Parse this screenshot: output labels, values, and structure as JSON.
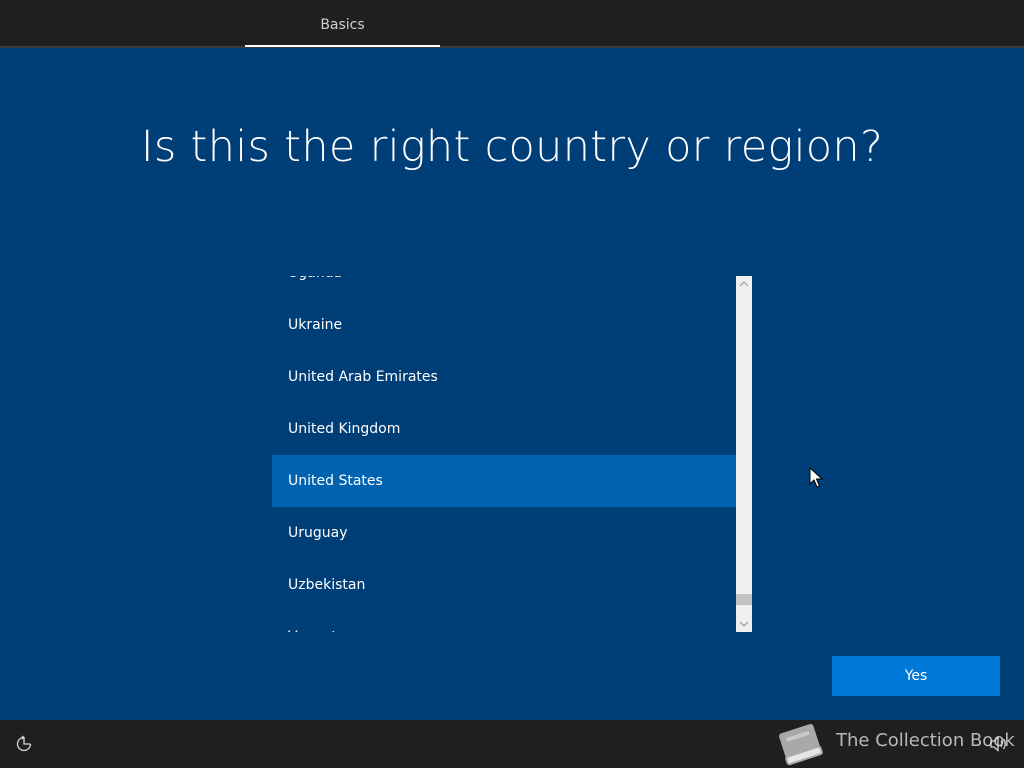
{
  "header": {
    "tabs": [
      {
        "label": "Basics",
        "active": true
      }
    ]
  },
  "page": {
    "title": "Is this the right country or region?"
  },
  "country_list": {
    "items": [
      {
        "label": "Uganda"
      },
      {
        "label": "Ukraine"
      },
      {
        "label": "United Arab Emirates"
      },
      {
        "label": "United Kingdom"
      },
      {
        "label": "United States",
        "selected": true
      },
      {
        "label": "Uruguay"
      },
      {
        "label": "Uzbekistan"
      },
      {
        "label": "Vanuatu"
      }
    ]
  },
  "actions": {
    "yes_label": "Yes"
  },
  "footer": {
    "left_icon": "ease-of-access-icon",
    "right_icon": "volume-icon",
    "watermark_text": "The Collection Book",
    "watermark_icon": "book-icon"
  },
  "colors": {
    "background": "#003e78",
    "selected_item": "#0063b1",
    "primary_button": "#0078d7",
    "bars": "#1f1f1f"
  }
}
